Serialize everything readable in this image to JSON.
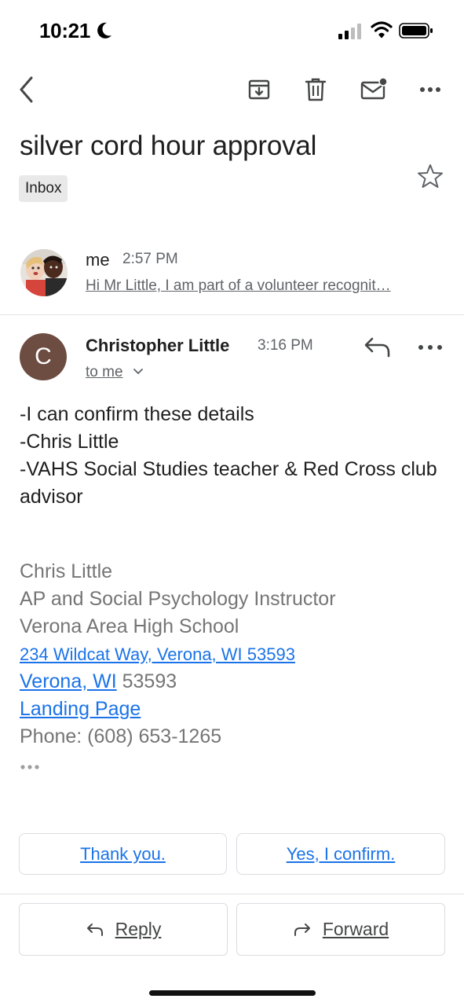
{
  "status_bar": {
    "time": "10:21",
    "icons": [
      "moon-icon",
      "signal-icon",
      "wifi-icon",
      "battery-icon"
    ]
  },
  "toolbar": {
    "icons": [
      "back-icon",
      "archive-icon",
      "delete-icon",
      "mark-unread-icon",
      "more-icon"
    ]
  },
  "email": {
    "subject": "silver cord hour approval",
    "label": "Inbox"
  },
  "collapsed_message": {
    "sender": "me",
    "time": "2:57 PM",
    "snippet": "Hi Mr Little, I am part of a volunteer recognit…"
  },
  "message": {
    "avatar_letter": "C",
    "avatar_color": "#6d4c41",
    "sender": "Christopher Little",
    "time": "3:16 PM",
    "recipient": "to me",
    "body": [
      "-I can confirm these details",
      "-Chris Little",
      "-VAHS Social Studies teacher & Red Cross club advisor"
    ],
    "signature": {
      "name": "Chris Little",
      "title": "AP and Social Psychology Instructor",
      "school": "Verona Area High School",
      "address_link": "234 Wildcat Way, Verona, WI 53593",
      "city_link": "Verona, WI",
      "zip": " 53593",
      "landing_link": "Landing Page",
      "phone": "Phone: (608) 653-1265"
    }
  },
  "smart_replies": [
    "Thank you.",
    "Yes, I confirm."
  ],
  "actions": {
    "reply": "Reply",
    "forward": "Forward"
  },
  "colors": {
    "link": "#1a73e8",
    "secondary_text": "#5f6368",
    "signature_text": "#757575"
  }
}
